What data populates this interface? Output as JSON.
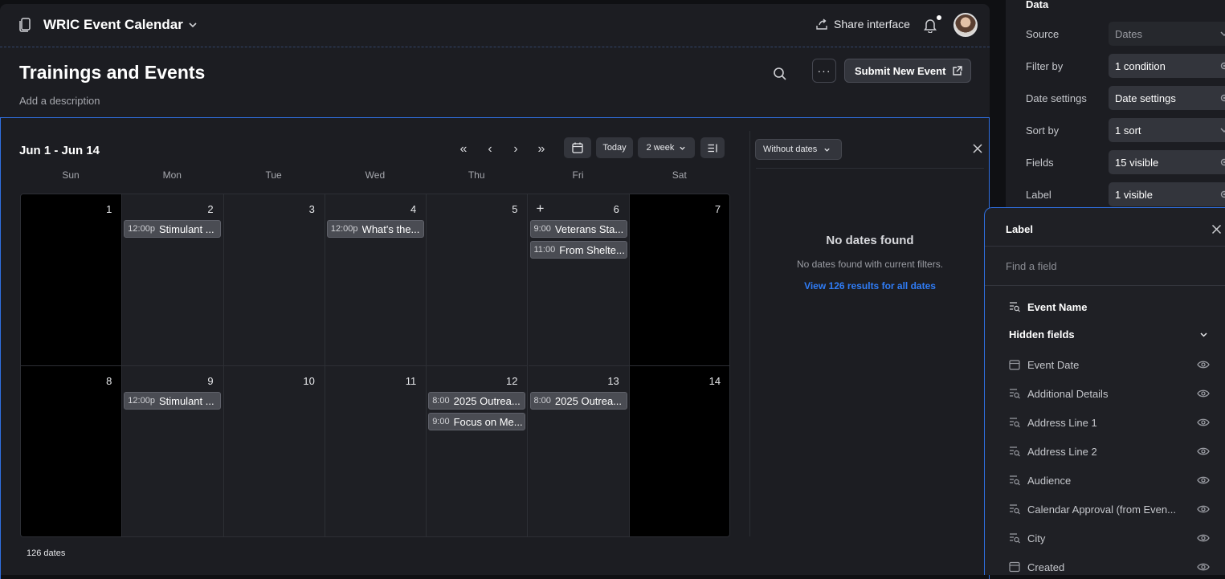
{
  "app": {
    "title": "WRIC Event Calendar",
    "share_label": "Share interface"
  },
  "page": {
    "title": "Trainings and Events",
    "description_placeholder": "Add a description",
    "submit_label": "Submit New Event",
    "more_label": "···"
  },
  "calendar": {
    "range": "Jun 1 - Jun 14",
    "today_label": "Today",
    "view_label": "2 week",
    "days_of_week": [
      "Sun",
      "Mon",
      "Tue",
      "Wed",
      "Thu",
      "Fri",
      "Sat"
    ],
    "weeks": [
      [
        {
          "day": "1",
          "weekend": true,
          "events": []
        },
        {
          "day": "2",
          "weekend": false,
          "events": [
            {
              "time": "12:00p",
              "name": "Stimulant ..."
            }
          ]
        },
        {
          "day": "3",
          "weekend": false,
          "events": []
        },
        {
          "day": "4",
          "weekend": false,
          "events": [
            {
              "time": "12:00p",
              "name": "What's the..."
            }
          ]
        },
        {
          "day": "5",
          "weekend": false,
          "events": []
        },
        {
          "day": "6",
          "weekend": false,
          "add": "+",
          "events": [
            {
              "time": "9:00",
              "name": "Veterans Sta..."
            },
            {
              "time": "11:00",
              "name": "From Shelte..."
            }
          ]
        },
        {
          "day": "7",
          "weekend": true,
          "events": []
        }
      ],
      [
        {
          "day": "8",
          "weekend": true,
          "events": []
        },
        {
          "day": "9",
          "weekend": false,
          "events": [
            {
              "time": "12:00p",
              "name": "Stimulant ..."
            }
          ]
        },
        {
          "day": "10",
          "weekend": false,
          "events": []
        },
        {
          "day": "11",
          "weekend": false,
          "events": []
        },
        {
          "day": "12",
          "weekend": false,
          "events": [
            {
              "time": "8:00",
              "name": "2025 Outrea..."
            },
            {
              "time": "9:00",
              "name": "Focus on Me..."
            }
          ]
        },
        {
          "day": "13",
          "weekend": false,
          "events": [
            {
              "time": "8:00",
              "name": "2025 Outrea..."
            }
          ]
        },
        {
          "day": "14",
          "weekend": true,
          "events": []
        }
      ]
    ],
    "count_label": "126 dates"
  },
  "undated": {
    "filter_label": "Without dates",
    "empty_title": "No dates found",
    "empty_sub": "No dates found with current filters.",
    "link": "View 126 results for all dates"
  },
  "settings": {
    "heading": "Data",
    "rows": [
      {
        "label": "Source",
        "value": "Dates"
      },
      {
        "label": "Filter by",
        "value": "1 condition"
      },
      {
        "label": "Date settings",
        "value": "Date settings"
      },
      {
        "label": "Sort by",
        "value": "1 sort"
      },
      {
        "label": "Fields",
        "value": "15 visible"
      },
      {
        "label": "Label",
        "value": "1 visible"
      }
    ]
  },
  "label_popup": {
    "title": "Label",
    "search_placeholder": "Find a field",
    "primary_field": "Event Name",
    "hidden_heading": "Hidden fields",
    "hidden_fields": [
      "Event Date",
      "Additional Details",
      "Address Line 1",
      "Address Line 2",
      "Audience",
      "Calendar Approval (from Even...",
      "City",
      "Created"
    ]
  },
  "colors": {
    "accent": "#2f6fe0",
    "link": "#2f7cf6",
    "weekend": "#000000"
  }
}
